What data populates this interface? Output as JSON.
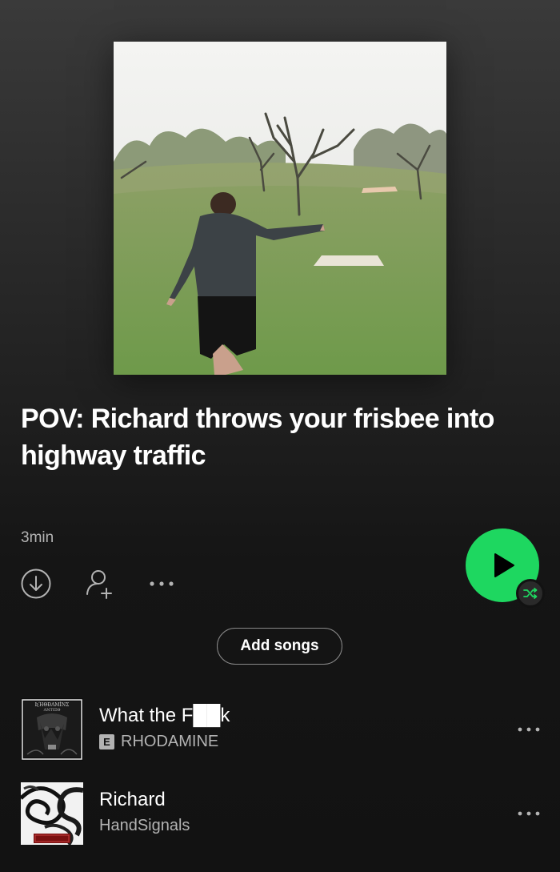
{
  "playlist": {
    "title": "POV: Richard throws your frisbee into highway traffic",
    "duration": "3min",
    "cover_image": "photo of a man throwing a frisbee on a disc golf field with bare trees"
  },
  "actions": {
    "download_icon": "download-circle-icon",
    "add_user_icon": "add-collaborator-icon",
    "more_icon": "more-horizontal-icon",
    "play_icon": "play-icon",
    "shuffle_icon": "shuffle-icon",
    "add_songs_label": "Add songs"
  },
  "colors": {
    "accent": "#1ed760",
    "background": "#121212",
    "secondary_text": "#b3b3b3"
  },
  "tracks": [
    {
      "name": "What the F██k",
      "artist": "RHODAMINE",
      "explicit": true,
      "explicit_label": "E",
      "art": "dark grayscale album art with gothic text"
    },
    {
      "name": "Richard",
      "artist": "HandSignals",
      "explicit": false,
      "art": "black and white swirl album art with red label"
    }
  ]
}
